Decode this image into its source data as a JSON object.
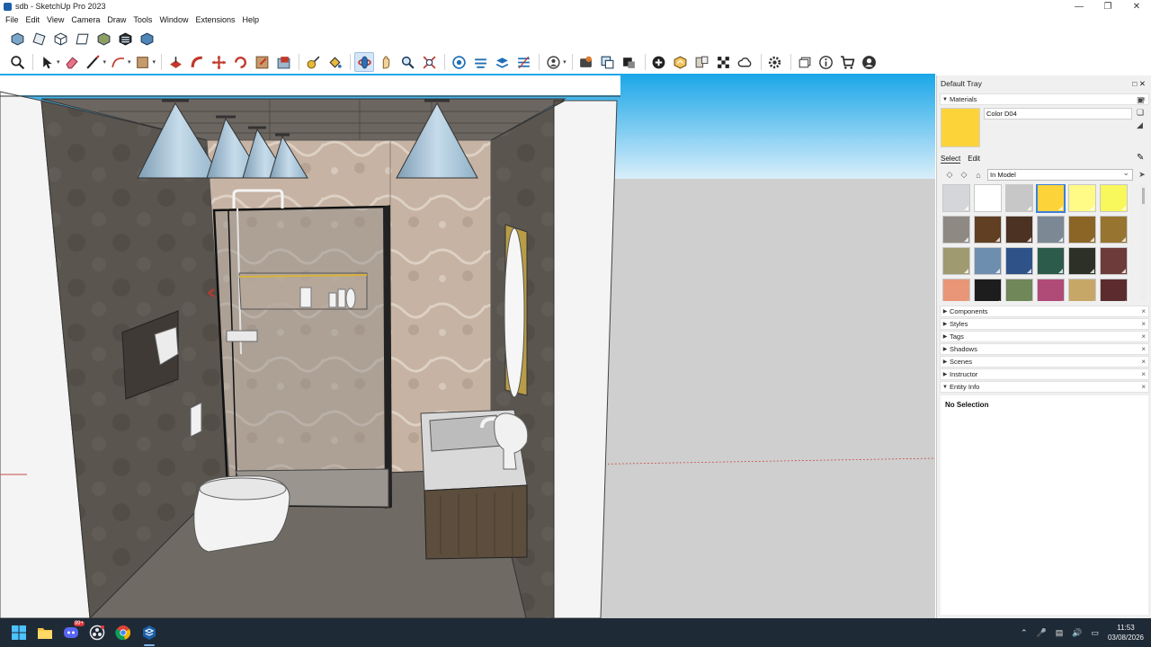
{
  "window": {
    "title": "sdb - SketchUp Pro 2023",
    "controls": [
      "minimize-icon",
      "maximize-icon",
      "close-icon"
    ]
  },
  "menu": [
    "File",
    "Edit",
    "View",
    "Camera",
    "Draw",
    "Tools",
    "Window",
    "Extensions",
    "Help"
  ],
  "toolbar_row1": [
    "iso-view-icon",
    "top-view-icon",
    "front-view-icon",
    "right-view-icon",
    "back-view-icon",
    "left-view-icon",
    "bottom-view-icon"
  ],
  "toolbar_row2": [
    "zoom-icon",
    "select-icon",
    "eraser-icon",
    "line-icon",
    "arc-icon",
    "shape-icon",
    "push-pull-icon",
    "follow-me-icon",
    "move-icon",
    "rotate-icon",
    "scale-icon",
    "offset-icon",
    "tape-measure-icon",
    "paint-bucket-icon",
    "orbit-icon",
    "pan-icon",
    "zoom-window-icon",
    "zoom-extents-icon",
    "section-plane-icon",
    "display-section-icon",
    "section-fill-icon",
    "section-cuts-icon",
    "outliner-icon",
    "3d-warehouse-icon",
    "extension-warehouse-icon",
    "layout-icon",
    "add-location-icon",
    "photo-textures-icon",
    "trimble-connect-icon",
    "styles-icon",
    "info-icon",
    "cart-icon",
    "account-icon"
  ],
  "tray": {
    "title": "Default Tray",
    "materials": {
      "header": "Materials",
      "current_name": "Color D04",
      "current_color": "#fdd33a",
      "tab_select": "Select",
      "tab_edit": "Edit",
      "library": "In Model",
      "swatches": [
        "#d4d6da",
        "#ffffff",
        "#c7c7c7",
        "#fdd33a",
        "#fffb86",
        "#f8f75c",
        "#8e8a83",
        "#603f22",
        "#4c3222",
        "#7c8894",
        "#8b6526",
        "#977530",
        "#a09a70",
        "#6d8eae",
        "#2f5289",
        "#2d5b4b",
        "#2c3026",
        "#6d3b39",
        "#e89677",
        "#1d1d1d",
        "#6f8759",
        "#b04a77",
        "#c7a768",
        "#5c2b2d"
      ],
      "selected_index": 3
    },
    "panels": [
      "Components",
      "Styles",
      "Tags",
      "Shadows",
      "Scenes",
      "Instructor",
      "Entity Info"
    ],
    "entity_info": "No Selection"
  },
  "taskbar": {
    "apps": [
      "windows-start-icon",
      "file-explorer-icon",
      "discord-icon",
      "obs-icon",
      "chrome-icon",
      "sketchup-icon"
    ],
    "discord_badge": "99+",
    "time": "11:53",
    "date": "03/08/2026"
  }
}
